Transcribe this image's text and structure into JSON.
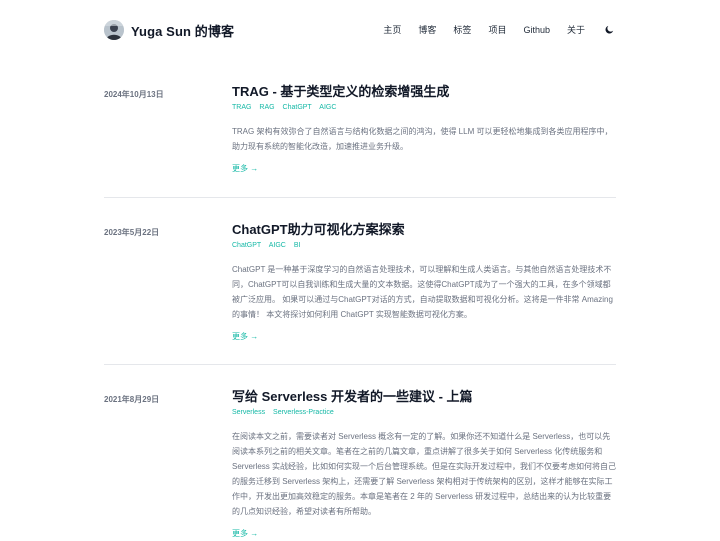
{
  "site": {
    "title": "Yuga Sun 的博客",
    "nav": [
      {
        "label": "主页"
      },
      {
        "label": "博客"
      },
      {
        "label": "标签"
      },
      {
        "label": "项目"
      },
      {
        "label": "Github"
      },
      {
        "label": "关于"
      }
    ],
    "theme_icon": "moon-icon",
    "accent_color": "#14b8a6"
  },
  "posts": [
    {
      "date": "2024年10月13日",
      "title": "TRAG - 基于类型定义的检索增强生成",
      "tags": [
        "TRAG",
        "RAG",
        "ChatGPT",
        "AIGC"
      ],
      "summary": "TRAG 架构有效弥合了自然语言与结构化数据之间的鸿沟，使得 LLM 可以更轻松地集成到各类应用程序中，助力现有系统的智能化改造，加速推进业务升级。",
      "more": "更多 →"
    },
    {
      "date": "2023年5月22日",
      "title": "ChatGPT助力可视化方案探索",
      "tags": [
        "ChatGPT",
        "AIGC",
        "BI"
      ],
      "summary": "ChatGPT 是一种基于深度学习的自然语言处理技术，可以理解和生成人类语言。与其他自然语言处理技术不同，ChatGPT可以自我训练和生成大量的文本数据。这使得ChatGPT成为了一个强大的工具，在多个领域都被广泛应用。 如果可以通过与ChatGPT对话的方式，自动提取数据和可视化分析。这将是一件非常 Amazing 的事情！ 本文将探讨如何利用 ChatGPT 实现智能数据可视化方案。",
      "more": "更多 →"
    },
    {
      "date": "2021年8月29日",
      "title": "写给 Serverless 开发者的一些建议 - 上篇",
      "tags": [
        "Serverless",
        "Serverless-Practice"
      ],
      "summary": "在阅读本文之前，需要读者对 Serverless 概念有一定的了解。如果你还不知道什么是 Serverless，也可以先阅读本系列之前的相关文章。笔者在之前的几篇文章，重点讲解了很多关于如何 Serverless 化传统服务和 Serverless 实战经验，比如如何实现一个后台管理系统。但是在实际开发过程中，我们不仅要考虑如何将自己的服务迁移到 Serverless 架构上，还需要了解 Serverless 架构相对于传统架构的区别，这样才能够在实际工作中，开发出更加高效稳定的服务。本章是笔者在 2 年的 Serverless 研发过程中，总结出来的认为比较重要的几点知识经验，希望对读者有所帮助。",
      "more": "更多 →"
    }
  ]
}
